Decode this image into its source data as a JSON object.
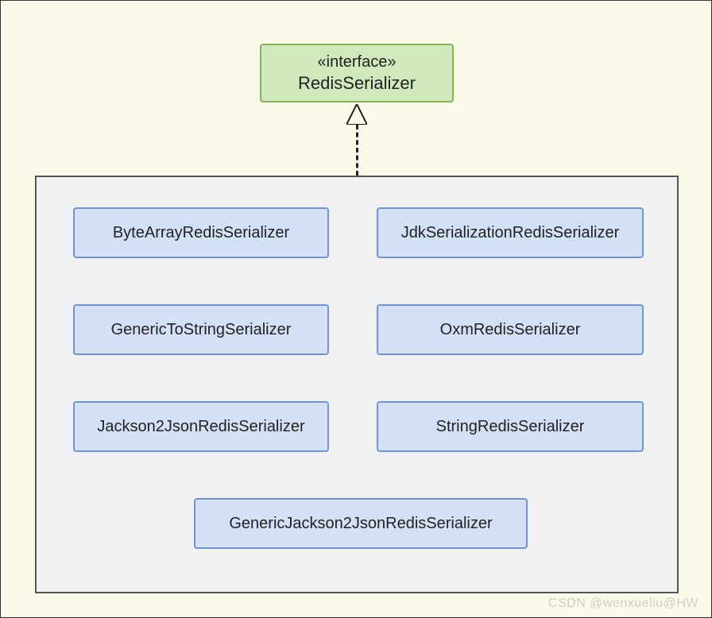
{
  "interface": {
    "stereotype": "«interface»",
    "name": "RedisSerializer"
  },
  "implementations": [
    "ByteArrayRedisSerializer",
    "JdkSerializationRedisSerializer",
    "GenericToStringSerializer",
    "OxmRedisSerializer",
    "Jackson2JsonRedisSerializer",
    "StringRedisSerializer",
    "GenericJackson2JsonRedisSerializer"
  ],
  "watermark": "CSDN @wenxueliu@HW",
  "colors": {
    "canvas_bg": "#fbfae9",
    "interface_fill": "#cfe8bc",
    "interface_stroke": "#87b15d",
    "class_fill": "#d3e0f6",
    "class_stroke": "#7594cf",
    "container_bg": "#f0f1f2"
  }
}
